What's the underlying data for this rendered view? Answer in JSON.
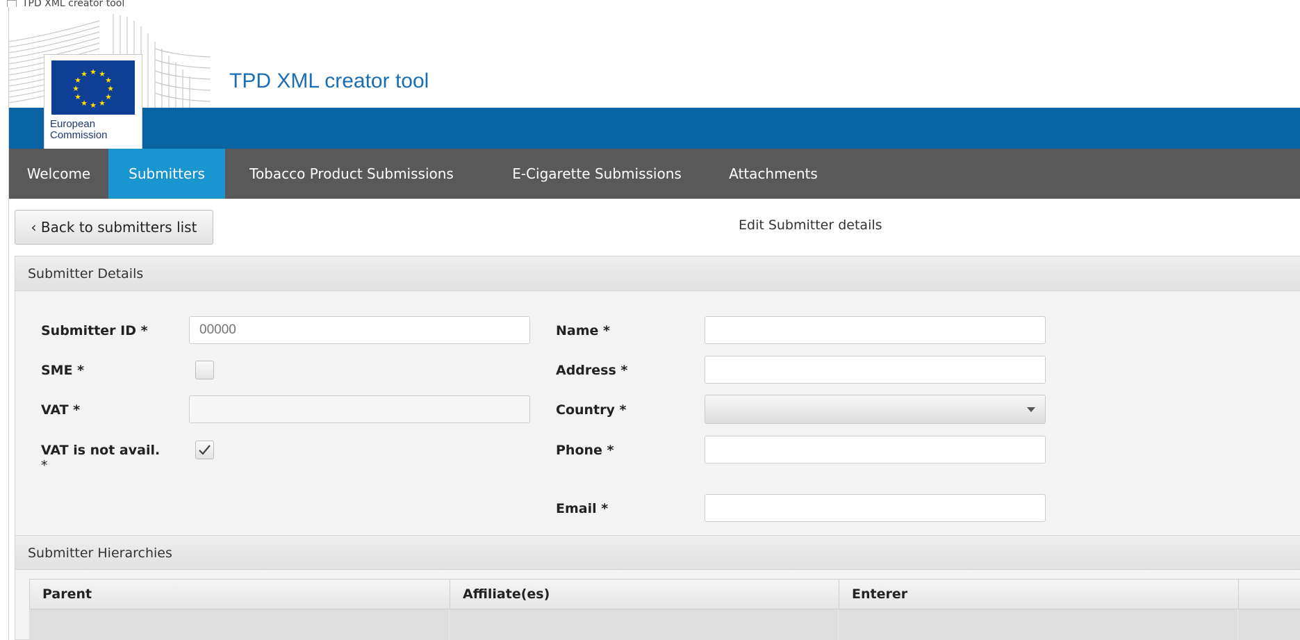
{
  "window": {
    "title": "TPD XML creator tool"
  },
  "header": {
    "logo_text_line1": "European",
    "logo_text_line2": "Commission",
    "app_title": "TPD XML creator tool",
    "colors": {
      "blue_band": "#0a64a4",
      "title": "#1a6eb3",
      "flag": "#0e3f95",
      "stars": "#ffdd00"
    }
  },
  "nav": {
    "items": [
      {
        "label": "Welcome"
      },
      {
        "label": "Submitters",
        "active": true
      },
      {
        "label": "Tobacco Product Submissions"
      },
      {
        "label": "E-Cigarette Submissions"
      },
      {
        "label": "Attachments"
      }
    ],
    "colors": {
      "bar": "#595959",
      "active": "#1b95cf"
    }
  },
  "toolbar": {
    "back_label": "Back to submitters list",
    "back_icon": "chevron-left-icon",
    "page_title": "Edit Submitter details"
  },
  "details": {
    "heading": "Submitter Details",
    "submitter_id": {
      "label": "Submitter ID *",
      "placeholder": "00000",
      "value": ""
    },
    "sme": {
      "label": "SME *",
      "checked": false
    },
    "vat": {
      "label": "VAT *",
      "value": ""
    },
    "vat_not_available": {
      "label_line1": "VAT is not avail.",
      "label_line2": "*",
      "checked": true
    },
    "name": {
      "label": "Name *",
      "value": ""
    },
    "address": {
      "label": "Address *",
      "value": ""
    },
    "country": {
      "label": "Country *",
      "value": ""
    },
    "phone": {
      "label": "Phone *",
      "value": ""
    },
    "email": {
      "label": "Email *",
      "value": ""
    }
  },
  "hierarchies": {
    "heading": "Submitter Hierarchies",
    "columns": [
      "Parent",
      "Affiliate(es)",
      "Enterer",
      ""
    ],
    "rows": [
      [
        "",
        "",
        "",
        ""
      ]
    ]
  }
}
